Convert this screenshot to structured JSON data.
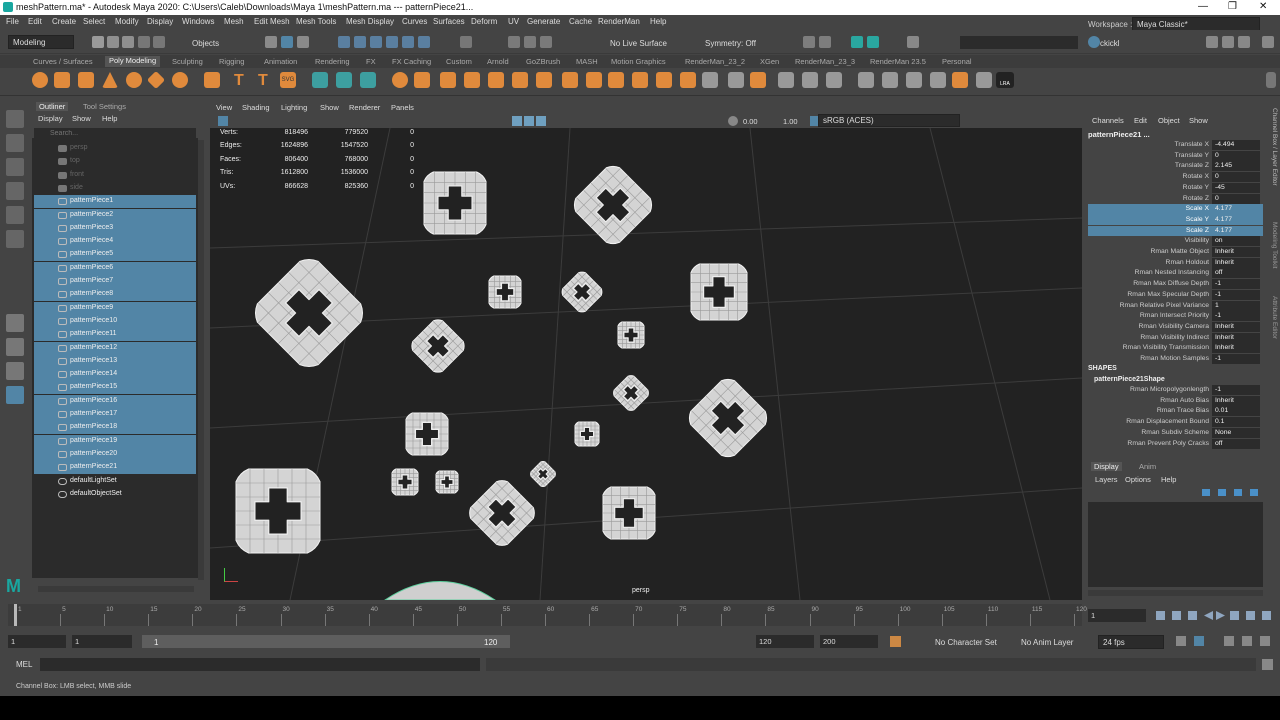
{
  "window": {
    "title": "meshPattern.ma* - Autodesk Maya 2020: C:\\Users\\Caleb\\Downloads\\Maya 1\\meshPattern.ma  ---  patternPiece21...",
    "controls": [
      "—",
      "❐",
      "✕"
    ]
  },
  "menubar": [
    "File",
    "Edit",
    "Create",
    "Select",
    "Modify",
    "Display",
    "Windows",
    "Mesh",
    "Edit Mesh",
    "Mesh Tools",
    "Mesh Display",
    "Curves",
    "Surfaces",
    "Deform",
    "UV",
    "Generate",
    "Cache",
    "RenderMan",
    "Help"
  ],
  "workspace": {
    "label": "Workspace :",
    "value": "Maya Classic*"
  },
  "statusline": {
    "menuset": "Modeling",
    "select_mode": "Objects",
    "live_surface": "No Live Surface",
    "symmetry": "Symmetry: Off",
    "user": "ckickl"
  },
  "shelf_tabs": [
    "Curves / Surfaces",
    "Poly Modeling",
    "Sculpting",
    "Rigging",
    "Animation",
    "Rendering",
    "FX",
    "FX Caching",
    "Custom",
    "Arnold",
    "GoZBrush",
    "MASH",
    "Motion Graphics",
    "RenderMan_23_2",
    "XGen",
    "RenderMan_23_3",
    "RenderMan 23.5",
    "Personal"
  ],
  "shelf_active": "Poly Modeling",
  "shelf_icon_text": {
    "svg": "SVG",
    "lra": "LRA"
  },
  "outliner": {
    "tabs": [
      "Outliner",
      "Tool Settings"
    ],
    "menu": [
      "Display",
      "Show",
      "Help"
    ],
    "search_placeholder": "Search...",
    "items": [
      {
        "label": "persp",
        "selected": false,
        "dim": true
      },
      {
        "label": "top",
        "selected": false,
        "dim": true
      },
      {
        "label": "front",
        "selected": false,
        "dim": true
      },
      {
        "label": "side",
        "selected": false,
        "dim": true
      },
      {
        "label": "patternPiece1",
        "selected": true,
        "dim": false
      },
      {
        "label": "patternPiece2",
        "selected": true,
        "dim": false
      },
      {
        "label": "patternPiece3",
        "selected": true,
        "dim": false
      },
      {
        "label": "patternPiece4",
        "selected": true,
        "dim": false
      },
      {
        "label": "patternPiece5",
        "selected": true,
        "dim": false
      },
      {
        "label": "patternPiece6",
        "selected": true,
        "dim": false
      },
      {
        "label": "patternPiece7",
        "selected": true,
        "dim": false
      },
      {
        "label": "patternPiece8",
        "selected": true,
        "dim": false
      },
      {
        "label": "patternPiece9",
        "selected": true,
        "dim": false
      },
      {
        "label": "patternPiece10",
        "selected": true,
        "dim": false
      },
      {
        "label": "patternPiece11",
        "selected": true,
        "dim": false
      },
      {
        "label": "patternPiece12",
        "selected": true,
        "dim": false
      },
      {
        "label": "patternPiece13",
        "selected": true,
        "dim": false
      },
      {
        "label": "patternPiece14",
        "selected": true,
        "dim": false
      },
      {
        "label": "patternPiece15",
        "selected": true,
        "dim": false
      },
      {
        "label": "patternPiece16",
        "selected": true,
        "dim": false
      },
      {
        "label": "patternPiece17",
        "selected": true,
        "dim": false
      },
      {
        "label": "patternPiece18",
        "selected": true,
        "dim": false
      },
      {
        "label": "patternPiece19",
        "selected": true,
        "dim": false
      },
      {
        "label": "patternPiece20",
        "selected": true,
        "dim": false
      },
      {
        "label": "patternPiece21",
        "selected": true,
        "dim": false
      },
      {
        "label": "defaultLightSet",
        "selected": false,
        "dim": false
      },
      {
        "label": "defaultObjectSet",
        "selected": false,
        "dim": false
      }
    ]
  },
  "viewport": {
    "menu": [
      "View",
      "Shading",
      "Lighting",
      "Show",
      "Renderer",
      "Panels"
    ],
    "exposure": "0.00",
    "gamma": "1.00",
    "colorspace": "sRGB (ACES)",
    "camera_label": "persp",
    "hud": [
      {
        "label": "Verts:",
        "a": "818496",
        "b": "779520",
        "c": "0"
      },
      {
        "label": "Edges:",
        "a": "1624896",
        "b": "1547520",
        "c": "0"
      },
      {
        "label": "Faces:",
        "a": "806400",
        "b": "768000",
        "c": "0"
      },
      {
        "label": "Tris:",
        "a": "1612800",
        "b": "1536000",
        "c": "0"
      },
      {
        "label": "UVs:",
        "a": "866628",
        "b": "825360",
        "c": "0"
      }
    ]
  },
  "channelbox": {
    "menu": [
      "Channels",
      "Edit",
      "Object",
      "Show"
    ],
    "object": "patternPiece21 ...",
    "attributes": [
      {
        "name": "Translate X",
        "value": "-4.494",
        "selected": false
      },
      {
        "name": "Translate Y",
        "value": "0",
        "selected": false
      },
      {
        "name": "Translate Z",
        "value": "2.145",
        "selected": false
      },
      {
        "name": "Rotate X",
        "value": "0",
        "selected": false
      },
      {
        "name": "Rotate Y",
        "value": "-45",
        "selected": false
      },
      {
        "name": "Rotate Z",
        "value": "0",
        "selected": false
      },
      {
        "name": "Scale X",
        "value": "4.177",
        "selected": true
      },
      {
        "name": "Scale Y",
        "value": "4.177",
        "selected": true
      },
      {
        "name": "Scale Z",
        "value": "4.177",
        "selected": true
      },
      {
        "name": "Visibility",
        "value": "on",
        "selected": false
      },
      {
        "name": "Rman Matte Object",
        "value": "Inherit",
        "selected": false
      },
      {
        "name": "Rman Holdout",
        "value": "Inherit",
        "selected": false
      },
      {
        "name": "Rman Nested Instancing",
        "value": "off",
        "selected": false
      },
      {
        "name": "Rman Max Diffuse Depth",
        "value": "-1",
        "selected": false
      },
      {
        "name": "Rman Max Specular Depth",
        "value": "-1",
        "selected": false
      },
      {
        "name": "Rman Relative Pixel Variance",
        "value": "1",
        "selected": false
      },
      {
        "name": "Rman Intersect Priority",
        "value": "-1",
        "selected": false
      },
      {
        "name": "Rman Visibility Camera",
        "value": "Inherit",
        "selected": false
      },
      {
        "name": "Rman Visibility Indirect",
        "value": "Inherit",
        "selected": false
      },
      {
        "name": "Rman Visibility Transmission",
        "value": "Inherit",
        "selected": false
      },
      {
        "name": "Rman Motion Samples",
        "value": "-1",
        "selected": false
      }
    ],
    "shapes_header": "SHAPES",
    "shape_name": "patternPiece21Shape",
    "shape_attributes": [
      {
        "name": "Rman Micropolygonlength",
        "value": "-1"
      },
      {
        "name": "Rman Auto Bias",
        "value": "Inherit"
      },
      {
        "name": "Rman Trace Bias",
        "value": "0.01"
      },
      {
        "name": "Rman Displacement Bound",
        "value": "0.1"
      },
      {
        "name": "Rman Subdiv Scheme",
        "value": "None"
      },
      {
        "name": "Rman Prevent Poly Cracks",
        "value": "off"
      }
    ],
    "layer_tabs": [
      "Display",
      "Anim"
    ],
    "layer_menu": [
      "Layers",
      "Options",
      "Help"
    ]
  },
  "side_tabs": [
    "Channel Box / Layer Editor",
    "Modeling Toolkit",
    "Attribute Editor"
  ],
  "timeline": {
    "ticks": [
      "1",
      "5",
      "10",
      "15",
      "20",
      "25",
      "30",
      "35",
      "40",
      "45",
      "50",
      "55",
      "60",
      "65",
      "70",
      "75",
      "80",
      "85",
      "90",
      "95",
      "100",
      "105",
      "110",
      "115",
      "120"
    ],
    "current_frame": "1",
    "range_start": "1",
    "range_start_inner": "1",
    "range_slider_start": "1",
    "range_slider_end": "120",
    "range_end_inner": "120",
    "range_end": "200",
    "character_set": "No Character Set",
    "anim_layer": "No Anim Layer",
    "fps": "24 fps"
  },
  "mel_label": "MEL",
  "help_line": "Channel Box: LMB select, MMB slide",
  "colors": {
    "selection": "#5285a6",
    "panel": "#444444",
    "field": "#2b2b2b",
    "viewport_bg": "#222222",
    "mesh": "#d4d4d4"
  }
}
